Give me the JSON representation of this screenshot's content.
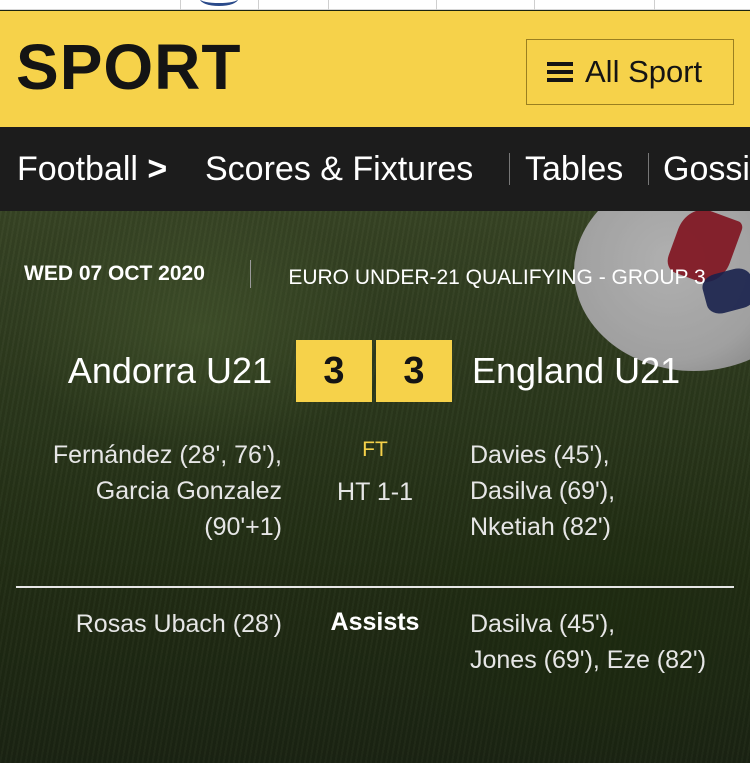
{
  "header": {
    "logo": "SPORT",
    "all_sport_label": "All Sport"
  },
  "nav": {
    "items": [
      {
        "label": "Football"
      },
      {
        "label": "Scores & Fixtures"
      },
      {
        "label": "Tables"
      },
      {
        "label": "Gossi"
      }
    ]
  },
  "match": {
    "date": "WED 07 OCT 2020",
    "competition": "EURO UNDER-21 QUALIFYING - GROUP 3",
    "home_team": "Andorra U21",
    "away_team": "England U21",
    "home_score": "3",
    "away_score": "3",
    "status": "FT",
    "half_time": "HT 1-1",
    "home_scorers": [
      "Fernández (28', 76'),",
      "Garcia Gonzalez",
      "(90'+1)"
    ],
    "away_scorers": [
      "Davies (45'),",
      "Dasilva (69'),",
      "Nketiah (82')"
    ],
    "assists_label": "Assists",
    "home_assists": [
      "Rosas Ubach (28')"
    ],
    "away_assists": [
      "Dasilva (45'),",
      "Jones (69'), Eze (82')"
    ]
  },
  "colors": {
    "accent_yellow": "#f6d24a",
    "nav_background": "#1c1c1c"
  },
  "icons": {
    "menu": "hamburger-icon",
    "nav_chevron": "chevron-right-icon"
  }
}
